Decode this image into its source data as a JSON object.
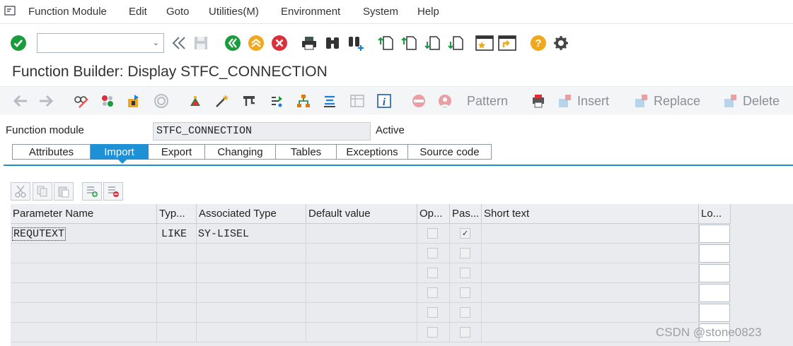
{
  "menu": {
    "items": [
      "Function Module",
      "Edit",
      "Goto",
      "Utilities(M)",
      "Environment",
      "System",
      "Help"
    ]
  },
  "toolbar1": {
    "command_value": "",
    "icons": [
      "enter-icon",
      "back-double-icon",
      "save-icon",
      "back-icon",
      "exit-icon",
      "cancel-icon",
      "print-icon",
      "find-icon",
      "find-next-icon",
      "first-page-icon",
      "prev-page-icon",
      "next-page-icon",
      "last-page-icon",
      "create-session-icon",
      "shortcut-icon",
      "help-icon",
      "customize-icon"
    ]
  },
  "header": {
    "title": "Function Builder: Display STFC_CONNECTION"
  },
  "toolbar2": {
    "pattern_label": "Pattern",
    "insert_label": "Insert",
    "replace_label": "Replace",
    "delete_label": "Delete"
  },
  "function_module": {
    "label": "Function module",
    "value": "STFC_CONNECTION",
    "status": "Active"
  },
  "tabs": [
    {
      "label": "Attributes"
    },
    {
      "label": "Import"
    },
    {
      "label": "Export"
    },
    {
      "label": "Changing"
    },
    {
      "label": "Tables"
    },
    {
      "label": "Exceptions"
    },
    {
      "label": "Source code"
    }
  ],
  "active_tab": "Import",
  "grid": {
    "columns": [
      "Parameter Name",
      "Typ...",
      "Associated Type",
      "Default value",
      "Op...",
      "Pas...",
      "Short text",
      "Lo..."
    ],
    "rows": [
      {
        "name": "REQUTEXT",
        "typing": "LIKE",
        "assoc_type": "SY-LISEL",
        "default": "",
        "optional": false,
        "pass_value": true,
        "short_text": ""
      },
      {
        "name": "",
        "typing": "",
        "assoc_type": "",
        "default": "",
        "optional": false,
        "pass_value": false,
        "short_text": ""
      },
      {
        "name": "",
        "typing": "",
        "assoc_type": "",
        "default": "",
        "optional": false,
        "pass_value": false,
        "short_text": ""
      },
      {
        "name": "",
        "typing": "",
        "assoc_type": "",
        "default": "",
        "optional": false,
        "pass_value": false,
        "short_text": ""
      },
      {
        "name": "",
        "typing": "",
        "assoc_type": "",
        "default": "",
        "optional": false,
        "pass_value": false,
        "short_text": ""
      },
      {
        "name": "",
        "typing": "",
        "assoc_type": "",
        "default": "",
        "optional": false,
        "pass_value": false,
        "short_text": ""
      }
    ]
  },
  "watermark": "CSDN @stone0823",
  "colors": {
    "accent": "#1e90d6",
    "ok_green": "#1a9c3c",
    "cancel_red": "#d9303c",
    "warn_orange": "#f0a81c"
  }
}
